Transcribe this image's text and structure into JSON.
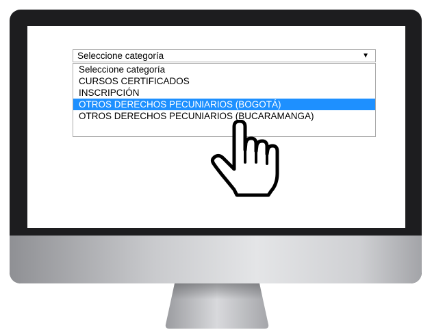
{
  "select": {
    "current_value": "Seleccione categoría",
    "caret": "▼",
    "options": [
      {
        "label": "Seleccione categoría",
        "selected": false
      },
      {
        "label": "CURSOS CERTIFICADOS",
        "selected": false
      },
      {
        "label": "INSCRIPCIÓN",
        "selected": false
      },
      {
        "label": "OTROS DERECHOS PECUNIARIOS (BOGOTÁ)",
        "selected": true
      },
      {
        "label": "OTROS DERECHOS PECUNIARIOS (BUCARAMANGA)",
        "selected": false
      }
    ]
  },
  "cursor": {
    "icon": "hand-pointer-icon"
  },
  "colors": {
    "highlight": "#1e90ff",
    "bezel": "#1d1d1f"
  }
}
